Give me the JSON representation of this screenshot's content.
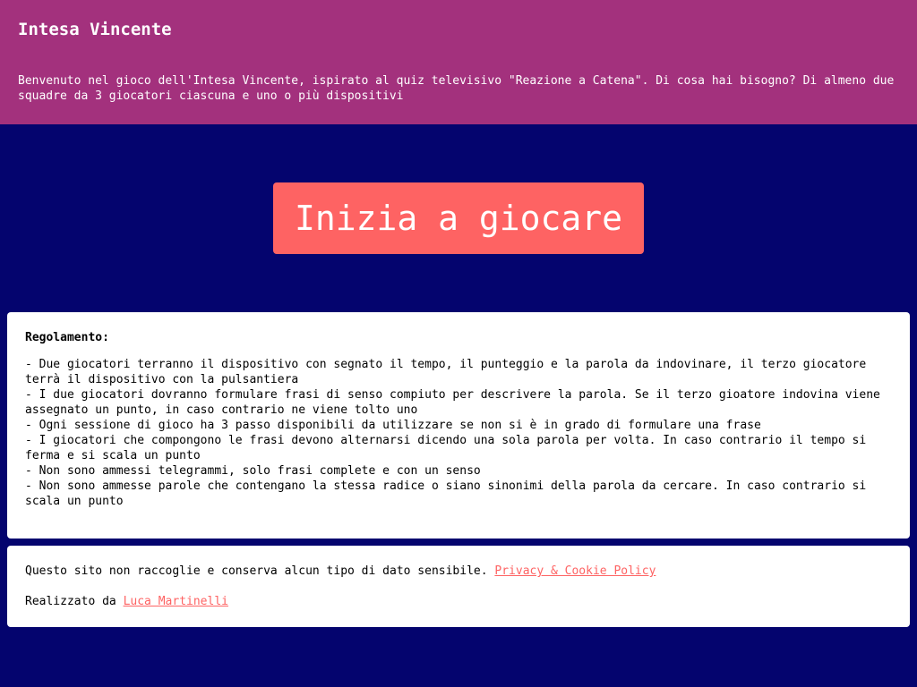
{
  "header": {
    "title": "Intesa Vincente",
    "intro": "Benvenuto nel gioco dell'Intesa Vincente, ispirato al quiz televisivo \"Reazione a Catena\". Di cosa hai bisogno? Di almeno due squadre da 3 giocatori ciascuna e uno o più dispositivi"
  },
  "hero": {
    "start_label": "Inizia a giocare"
  },
  "rules": {
    "title": "Regolamento:",
    "items": [
      "- Due giocatori terranno il dispositivo con segnato il tempo, il punteggio e la parola da indovinare, il terzo giocatore terrà il dispositivo con la pulsantiera",
      "- I due giocatori dovranno formulare frasi di senso compiuto per descrivere la parola. Se il terzo gioatore indovina viene assegnato un punto, in caso contrario ne viene tolto uno",
      "- Ogni sessione di gioco ha 3 passo disponibili da utilizzare se non si è in grado di formulare una frase",
      "- I giocatori che compongono le frasi devono alternarsi dicendo una sola parola per volta. In caso contrario il tempo si ferma e si scala un punto",
      "- Non sono ammessi telegrammi, solo frasi complete e con un senso",
      "- Non sono ammesse parole che contengano la stessa radice o siano sinonimi della parola da cercare. In caso contrario si scala un punto"
    ]
  },
  "footer": {
    "privacy_text": "Questo sito non raccoglie e conserva alcun tipo di dato sensibile.",
    "privacy_link": "Privacy & Cookie Policy",
    "made_by_text": "Realizzato da",
    "author_link": "Luca Martinelli"
  },
  "colors": {
    "header_bg": "#a3317d",
    "page_bg": "#04046e",
    "accent": "#fe6363"
  }
}
